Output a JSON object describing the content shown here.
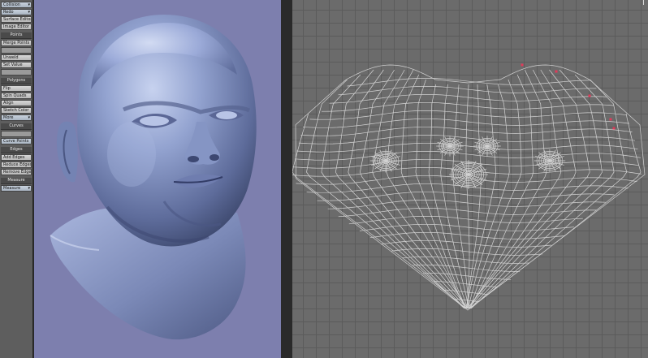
{
  "toolbar": {
    "top_controls": [
      {
        "label": "Collision",
        "kind": "dropdown"
      },
      {
        "label": "Redo",
        "kind": "dropdown"
      },
      {
        "label": "Surface Editor",
        "kind": "button"
      },
      {
        "label": "Image Editor",
        "kind": "button"
      }
    ],
    "groups": [
      {
        "title": "Points",
        "items": [
          {
            "label": "Merge Points",
            "kind": "button"
          },
          {
            "label": "",
            "kind": "disabled"
          },
          {
            "label": "Unweld",
            "kind": "button"
          },
          {
            "label": "Set Value",
            "kind": "button"
          },
          {
            "label": "",
            "kind": "disabled"
          }
        ]
      },
      {
        "title": "Polygons",
        "items": [
          {
            "label": "Flip",
            "kind": "button"
          },
          {
            "label": "Spin Quads",
            "kind": "button"
          },
          {
            "label": "Align",
            "kind": "button"
          },
          {
            "label": "Sketch Color",
            "kind": "button"
          },
          {
            "label": "More",
            "kind": "dropdown"
          }
        ]
      },
      {
        "title": "Curves",
        "items": [
          {
            "label": "",
            "kind": "disabled"
          },
          {
            "label": "Curve Points",
            "kind": "dropdown"
          }
        ]
      },
      {
        "title": "Edges",
        "items": [
          {
            "label": "Add Edges",
            "kind": "button"
          },
          {
            "label": "Reduce Edges",
            "kind": "button"
          },
          {
            "label": "Remove Edges",
            "kind": "button"
          }
        ]
      },
      {
        "title": "Measure",
        "items": [
          {
            "label": "Measure",
            "kind": "dropdown"
          }
        ]
      }
    ]
  },
  "viewport3d": {
    "background": "#7d7fae",
    "model_color": "#7d8fbe",
    "content": "head-model"
  },
  "uv_editor": {
    "background": "#6b6b6b",
    "grid_color": "#5b5b5b",
    "wire_color": "#e6e6e6",
    "selected_point_color": "#e23a5a",
    "selected_points": 5
  }
}
